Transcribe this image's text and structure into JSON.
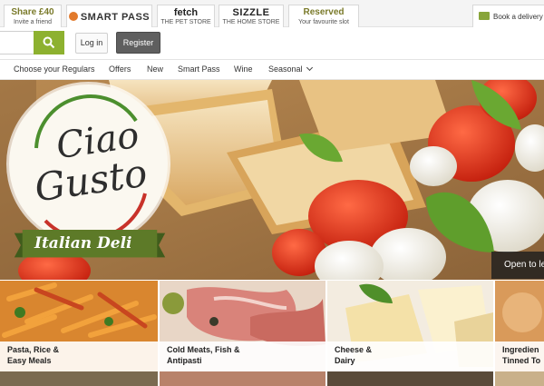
{
  "promo_tabs": {
    "share": {
      "line1": "Share £40",
      "line2": "Invite a friend"
    },
    "smart_pass": {
      "label": "SMART PASS"
    },
    "fetch": {
      "line1": "fetch",
      "line2": "THE PET STORE"
    },
    "sizzle": {
      "line1": "SIZZLE",
      "line2": "THE HOME STORE"
    },
    "reserved": {
      "line1": "Reserved",
      "line2": "Your favourite slot"
    },
    "delivery": {
      "label": "Book a delivery",
      "icon": "truck-icon"
    }
  },
  "header": {
    "search_placeholder": "",
    "search_icon": "search-icon",
    "login_label": "Log in",
    "register_label": "Register"
  },
  "nav": {
    "items": [
      {
        "label": "Choose your Regulars"
      },
      {
        "label": "Offers"
      },
      {
        "label": "New"
      },
      {
        "label": "Smart Pass"
      },
      {
        "label": "Wine"
      },
      {
        "label": "Seasonal"
      }
    ]
  },
  "hero": {
    "badge_line1": "Ciao",
    "badge_line2": "Gusto",
    "ribbon_text": "Italian Deli",
    "open_tab": "Open to le"
  },
  "tiles": [
    {
      "label": "Pasta, Rice &\nEasy Meals"
    },
    {
      "label": "Cold Meats, Fish &\nAntipasti"
    },
    {
      "label": "Cheese &\nDairy"
    },
    {
      "label": "Ingredien\nTinned To"
    }
  ],
  "colors": {
    "accent_green": "#8db12f",
    "promo_olive": "#7a7a2a",
    "ribbon_green": "#5d7a28"
  }
}
